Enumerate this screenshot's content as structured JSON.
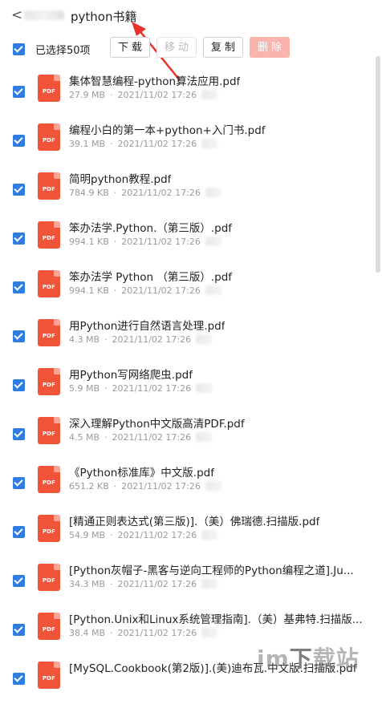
{
  "header": {
    "back_glyph": "<",
    "title": "python书籍"
  },
  "toolbar": {
    "selected_label": "已选择50项",
    "download": "下 载",
    "move": "移 动",
    "copy": "复 制",
    "delete": "删 除"
  },
  "files": [
    {
      "name": "集体智慧编程-python算法应用.pdf",
      "size": "27.9 MB",
      "date": "2021/11/02 17:26"
    },
    {
      "name": "编程小白的第一本+python+入门书.pdf",
      "size": "39.1 MB",
      "date": "2021/11/02 17:26"
    },
    {
      "name": "简明python教程.pdf",
      "size": "784.9 KB",
      "date": "2021/11/02 17:26"
    },
    {
      "name": "笨办法学.Python.（第三版）.pdf",
      "size": "994.1 KB",
      "date": "2021/11/02 17:26"
    },
    {
      "name": "笨办法学 Python （第三版）.pdf",
      "size": "994.1 KB",
      "date": "2021/11/02 17:26"
    },
    {
      "name": "用Python进行自然语言处理.pdf",
      "size": "4.3 MB",
      "date": "2021/11/02 17:26"
    },
    {
      "name": "用Python写网络爬虫.pdf",
      "size": "5.9 MB",
      "date": "2021/11/02 17:26"
    },
    {
      "name": "深入理解Python中文版高清PDF.pdf",
      "size": "4.5 MB",
      "date": "2021/11/02 17:26"
    },
    {
      "name": "《Python标准库》中文版.pdf",
      "size": "651.2 KB",
      "date": "2021/11/02 17:26"
    },
    {
      "name": "[精通正则表达式(第三版)].（美）佛瑞德.扫描版.pdf",
      "size": "54.9 MB",
      "date": "2021/11/02 17:26"
    },
    {
      "name": "[Python灰帽子-黑客与逆向工程师的Python编程之道].Ju...",
      "size": "34.3 MB",
      "date": "2021/11/02 17:26"
    },
    {
      "name": "[Python.Unix和Linux系统管理指南].（美）基弗特.扫描版...",
      "size": "38.4 MB",
      "date": "2021/11/02 17:26"
    },
    {
      "name": "[MySQL.Cookbook(第2版)].(美)迪布瓦.中文版.扫描版.pdf",
      "size": "",
      "date": ""
    }
  ],
  "file_icon_label": "PDF",
  "meta_separator": "·",
  "watermark": {
    "part1": "im",
    "part2": "下",
    "part3": "载站"
  },
  "colors": {
    "accent": "#2f7de1",
    "pdf_icon": "#f2543a",
    "delete_button": "#f9b4ad"
  }
}
